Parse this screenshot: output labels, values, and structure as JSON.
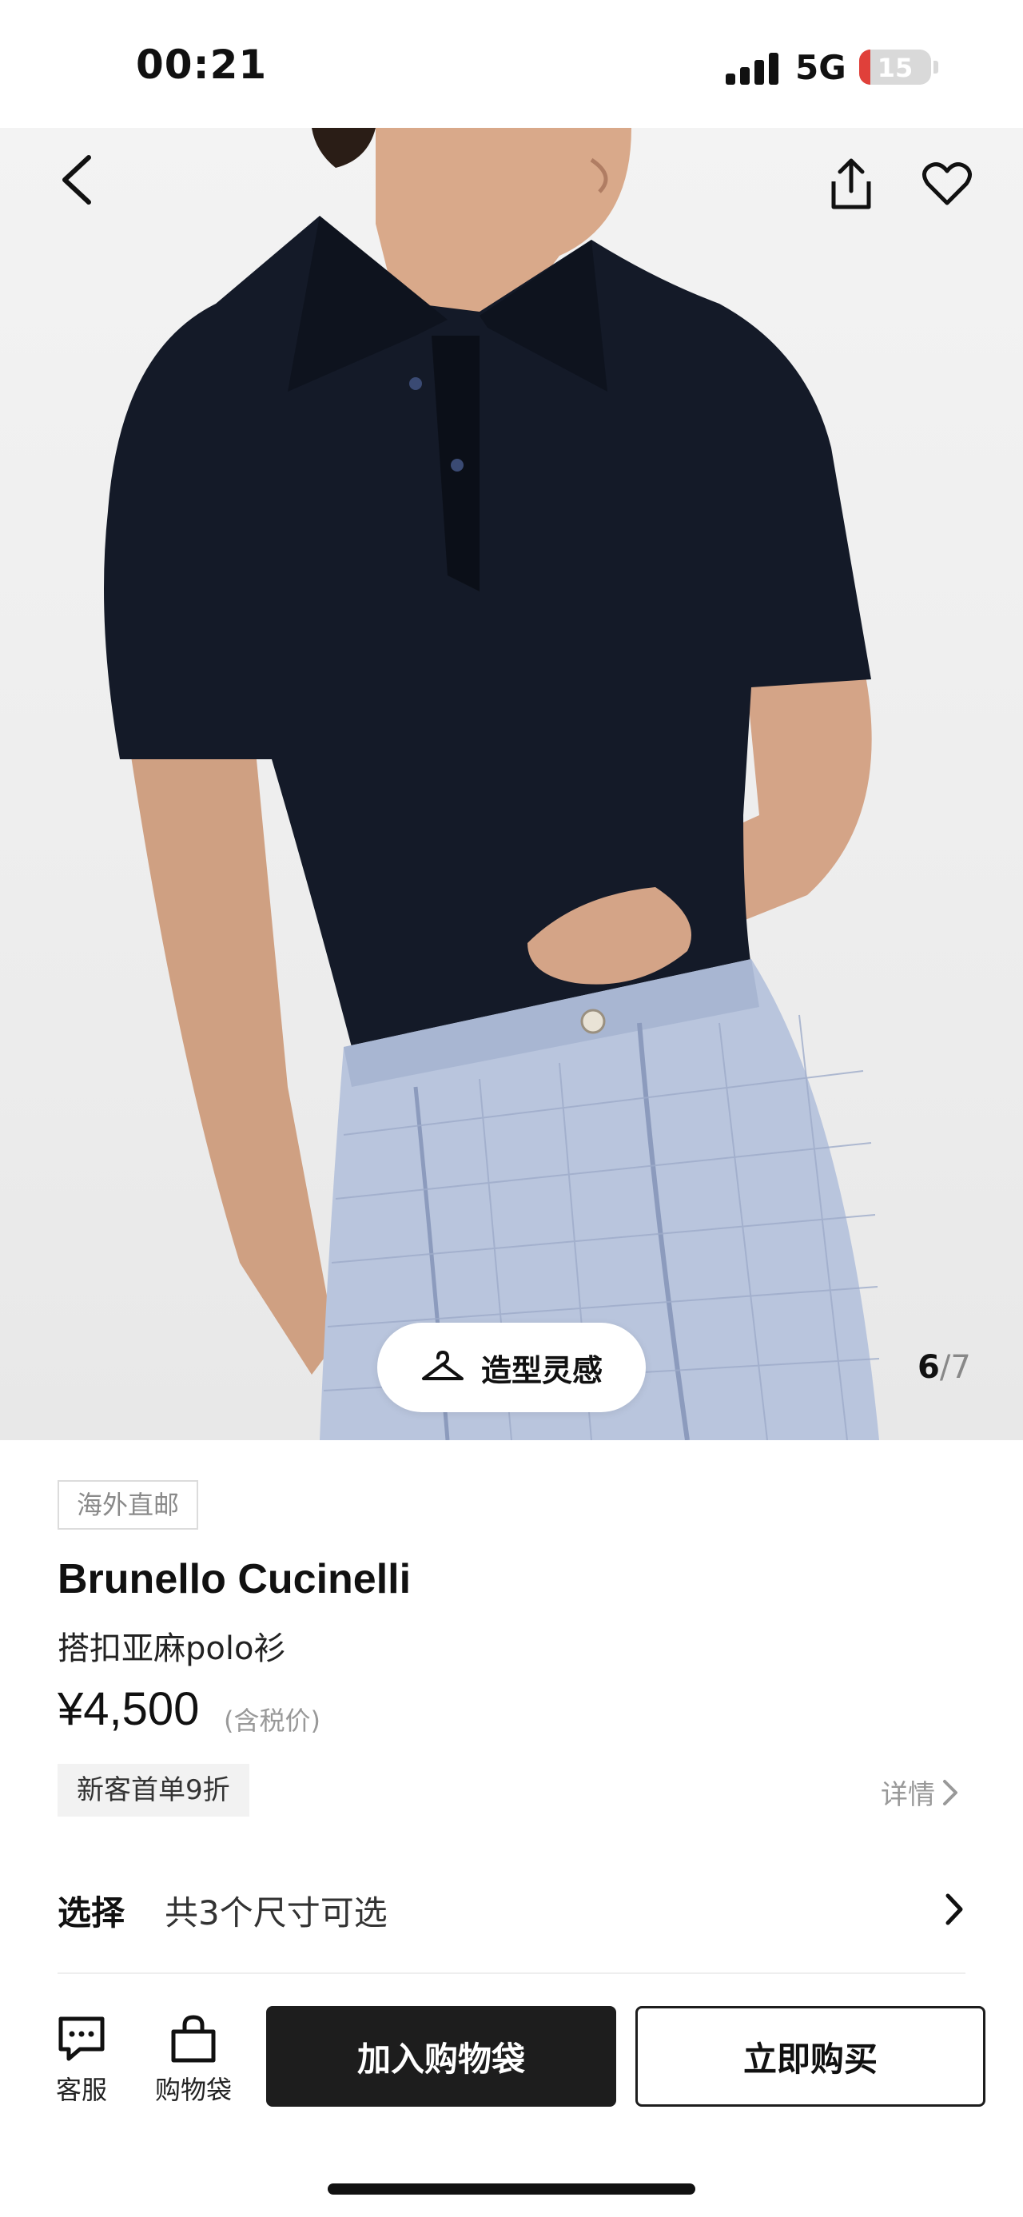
{
  "status_bar": {
    "time": "00:21",
    "network": "5G",
    "battery": "15",
    "battery_level_percent": 15,
    "battery_color": "#e0403a"
  },
  "hero": {
    "style_button_label": "造型灵感",
    "image_index": "6",
    "image_separator": "/",
    "image_total": "7",
    "icons": [
      "back-arrow-icon",
      "share-icon",
      "heart-icon",
      "hanger-icon"
    ]
  },
  "product": {
    "tag": "海外直邮",
    "brand": "Brunello Cucinelli",
    "name": "搭扣亚麻polo衫",
    "price": "¥4,500",
    "price_note": "(含税价)",
    "promo": "新客首单9折",
    "details_label": "详情"
  },
  "select": {
    "label": "选择",
    "value": "共3个尺寸可选"
  },
  "bottom_bar": {
    "service_label": "客服",
    "bag_label": "购物袋",
    "add_to_bag_label": "加入购物袋",
    "buy_now_label": "立即购买"
  },
  "colors": {
    "primary_button": "#1d1d1d",
    "tag_border": "#dcdcdc",
    "promo_bg": "#f2f2f2"
  }
}
